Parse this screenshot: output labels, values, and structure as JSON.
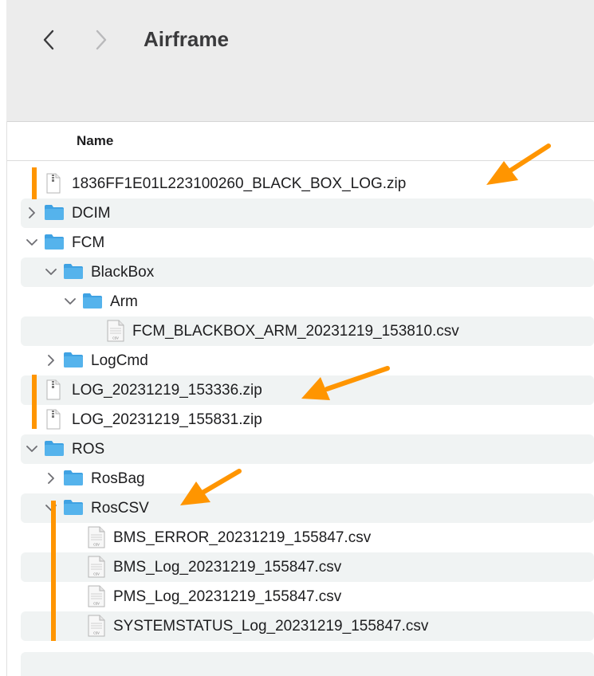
{
  "toolbar": {
    "title": "Airframe",
    "back_icon": "chevron-left-icon",
    "forward_icon": "chevron-right-icon"
  },
  "list": {
    "column_name": "Name",
    "rows": [
      {
        "name": "1836FF1E01L223100260_BLACK_BOX_LOG.zip",
        "kind": "zip",
        "depth": 0,
        "disclosure": "none"
      },
      {
        "name": "DCIM",
        "kind": "folder",
        "depth": 0,
        "disclosure": "collapsed"
      },
      {
        "name": "FCM",
        "kind": "folder",
        "depth": 0,
        "disclosure": "expanded"
      },
      {
        "name": "BlackBox",
        "kind": "folder",
        "depth": 1,
        "disclosure": "expanded"
      },
      {
        "name": "Arm",
        "kind": "folder",
        "depth": 2,
        "disclosure": "expanded"
      },
      {
        "name": "FCM_BLACKBOX_ARM_20231219_153810.csv",
        "kind": "csv",
        "depth": 3,
        "disclosure": "none"
      },
      {
        "name": "LogCmd",
        "kind": "folder",
        "depth": 1,
        "disclosure": "collapsed"
      },
      {
        "name": "LOG_20231219_153336.zip",
        "kind": "zip",
        "depth": 0,
        "disclosure": "none"
      },
      {
        "name": "LOG_20231219_155831.zip",
        "kind": "zip",
        "depth": 0,
        "disclosure": "none"
      },
      {
        "name": "ROS",
        "kind": "folder",
        "depth": 0,
        "disclosure": "expanded"
      },
      {
        "name": "RosBag",
        "kind": "folder",
        "depth": 1,
        "disclosure": "collapsed"
      },
      {
        "name": "RosCSV",
        "kind": "folder",
        "depth": 1,
        "disclosure": "expanded"
      },
      {
        "name": "BMS_ERROR_20231219_155847.csv",
        "kind": "csv",
        "depth": 2,
        "disclosure": "none"
      },
      {
        "name": "BMS_Log_20231219_155847.csv",
        "kind": "csv",
        "depth": 2,
        "disclosure": "none"
      },
      {
        "name": "PMS_Log_20231219_155847.csv",
        "kind": "csv",
        "depth": 2,
        "disclosure": "none"
      },
      {
        "name": "SYSTEMSTATUS_Log_20231219_155847.csv",
        "kind": "csv",
        "depth": 2,
        "disclosure": "none"
      }
    ]
  },
  "icons": {
    "folder": "folder-icon",
    "zip": "zip-archive-icon",
    "csv": "csv-file-icon",
    "csv_badge": "csv"
  },
  "colors": {
    "folder": "#55b3ec",
    "folder_tab": "#3fa2e3",
    "annotation": "#ff9500",
    "row_alt": "#f0f3f3",
    "toolbar": "#ececec"
  }
}
